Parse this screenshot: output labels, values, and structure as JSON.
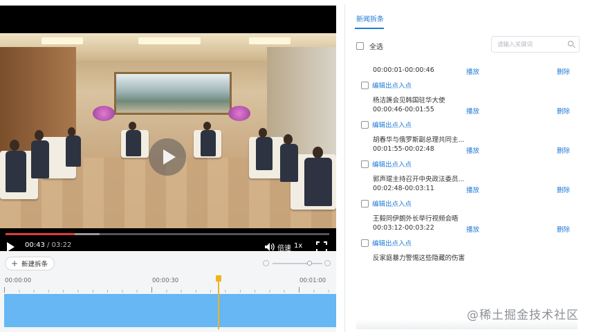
{
  "player": {
    "current_time": "00:43",
    "separator": "/",
    "duration": "03:22",
    "progress_played_fraction": 0.213,
    "progress_buffered_fraction": 0.29,
    "speed_label": "倍速",
    "speed_value": "1x"
  },
  "timeline": {
    "new_clip_label": "新建拆条",
    "ticks": [
      "00:00:00",
      "00:00:30",
      "00:01:00"
    ],
    "playhead_time": "00:00:43",
    "colors": {
      "playhead": "#f1b31c",
      "clip_track": "#66b7f4"
    }
  },
  "panel": {
    "tab_label": "新闻拆条",
    "select_all_label": "全选",
    "search_placeholder": "请输入关键词",
    "edit_label": "编辑出点入点",
    "play_label": "播放",
    "delete_label": "删除",
    "clips": [
      {
        "range": "00:00:01-00:00:46",
        "title": ""
      },
      {
        "range": "00:00:46-00:01:55",
        "title": "杨洁篪会见韩国驻华大使"
      },
      {
        "range": "00:01:55-00:02:48",
        "title": "胡春华与俄罗斯副总理共同主..."
      },
      {
        "range": "00:02:48-00:03:11",
        "title": "郭声琨主持召开中央政法委员..."
      },
      {
        "range": "00:03:12-00:03:22",
        "title": "王毅同伊朗外长举行视频会晤"
      },
      {
        "range": "",
        "title": "反家庭暴力警惕这些隐藏的伤害"
      }
    ]
  },
  "watermark": "@稀土掘金技术社区",
  "colors": {
    "accent": "#1f7ad8",
    "progress": "#e33c3c"
  }
}
